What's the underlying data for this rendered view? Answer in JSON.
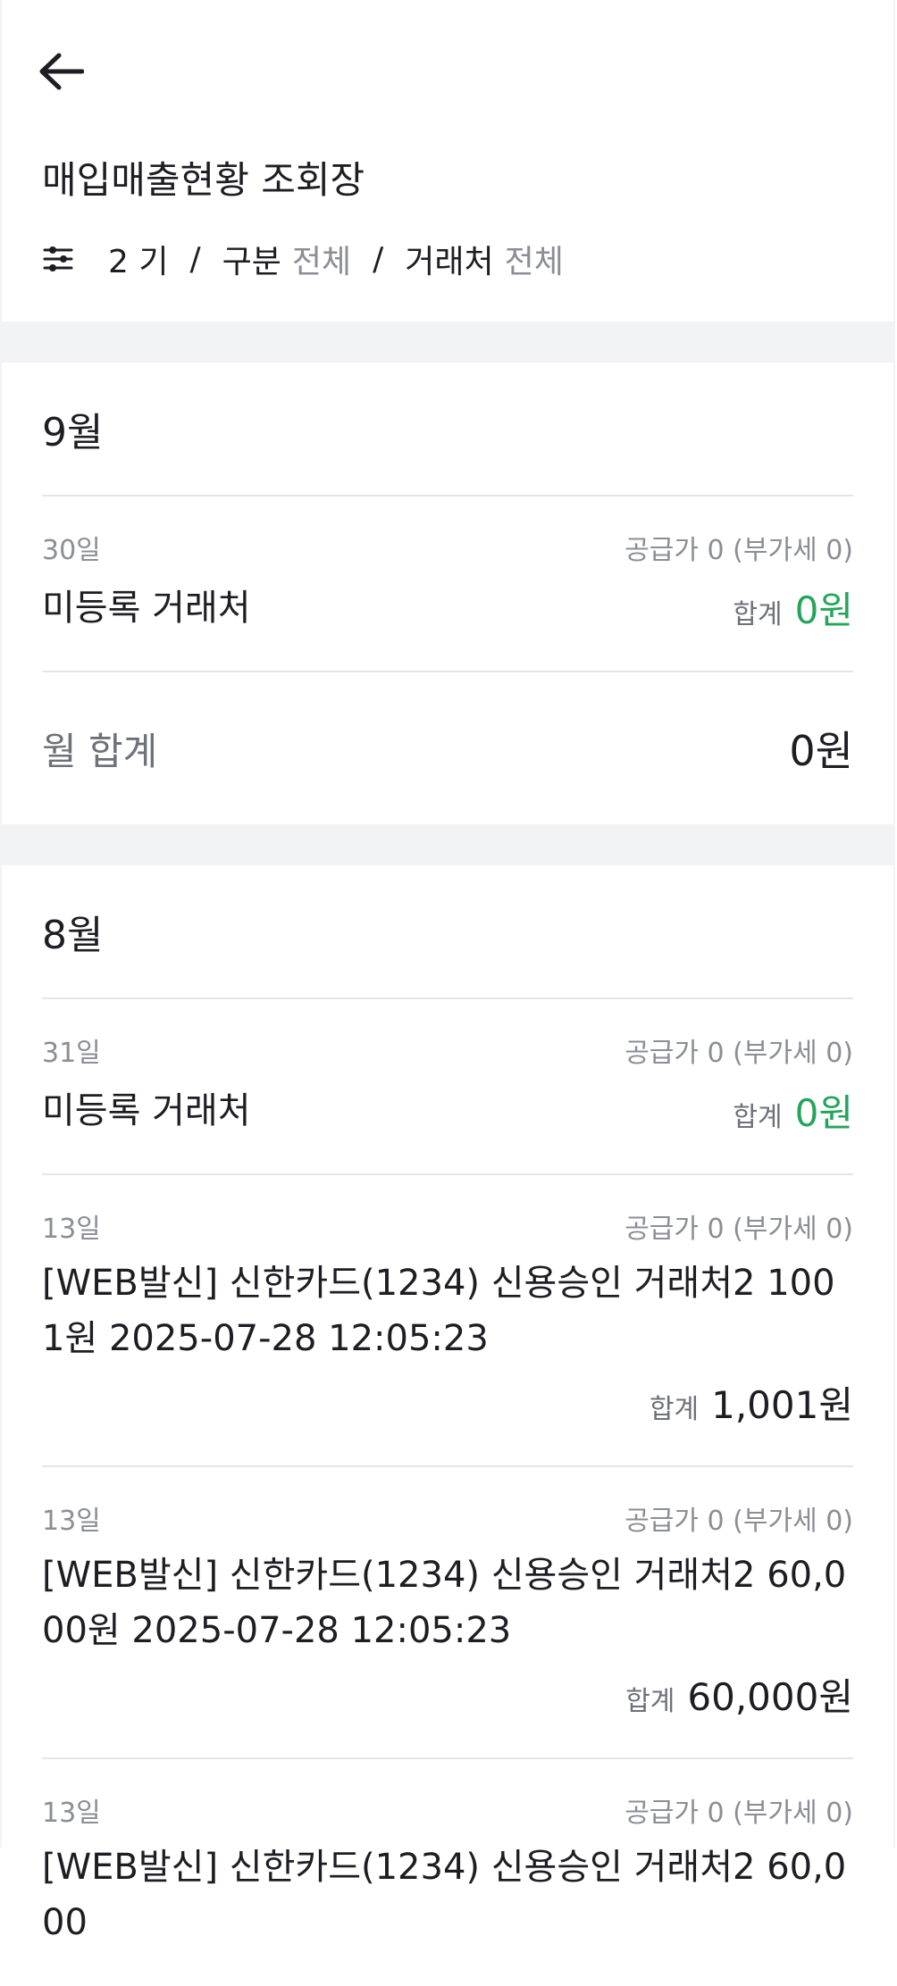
{
  "header": {
    "back_label": "back",
    "title": "매입매출현황 조회장"
  },
  "filter": {
    "period": "2 기",
    "separator": "/",
    "type_label": "구분",
    "type_value": "전체",
    "vendor_label": "거래처",
    "vendor_value": "전체"
  },
  "months": [
    {
      "title": "9월",
      "entries": [
        {
          "day": "30일",
          "supply": "공급가 0 (부가세 0)",
          "vendor": "미등록 거래처",
          "total_label": "합계",
          "total": "0원"
        }
      ],
      "sum_label": "월 합계",
      "sum_value": "0원"
    },
    {
      "title": "8월",
      "entries": [
        {
          "day": "31일",
          "supply": "공급가 0 (부가세 0)",
          "vendor": "미등록 거래처",
          "total_label": "합계",
          "total": "0원"
        },
        {
          "day": "13일",
          "supply": "공급가 0 (부가세 0)",
          "desc": "[WEB발신] 신한카드(1234) 신용승인 거래처2 1001원 2025-07-28 12:05:23",
          "total_label": "합계",
          "total": "1,001원"
        },
        {
          "day": "13일",
          "supply": "공급가 0 (부가세 0)",
          "desc": "[WEB발신] 신한카드(1234) 신용승인 거래처2 60,000원 2025-07-28 12:05:23",
          "total_label": "합계",
          "total": "60,000원"
        },
        {
          "day": "13일",
          "supply": "공급가 0 (부가세 0)",
          "desc": "[WEB발신] 신한카드(1234) 신용승인 거래처2 60,000"
        }
      ]
    }
  ],
  "colors": {
    "accent_green": "#25a55a",
    "muted": "#8b8e96",
    "divider": "#e4e5e8",
    "gap": "#f2f3f5"
  }
}
